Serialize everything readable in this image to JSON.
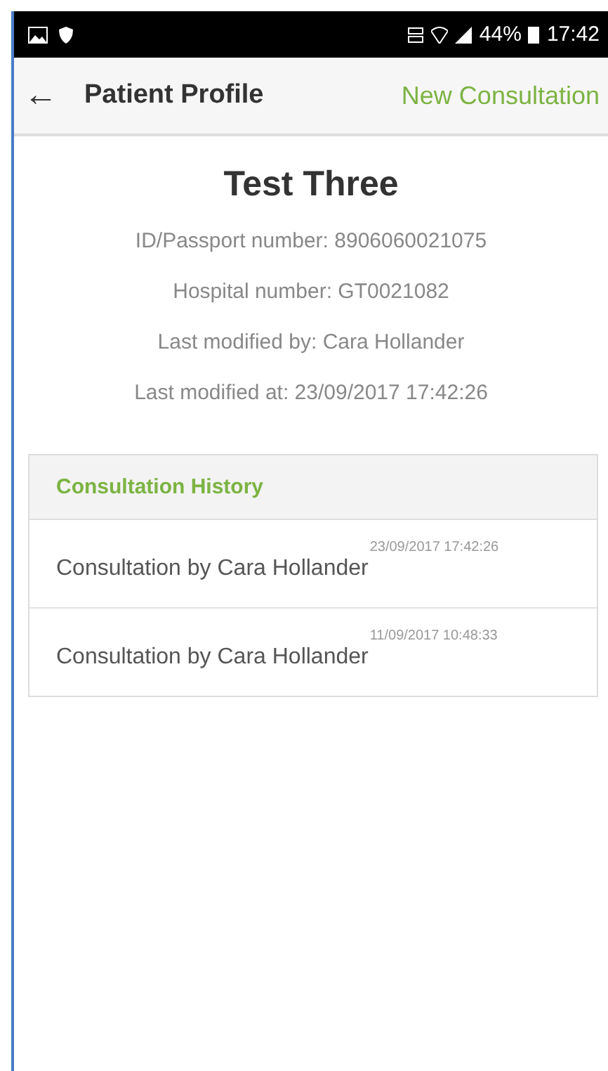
{
  "status_bar": {
    "battery": "44%",
    "time": "17:42"
  },
  "app_bar": {
    "back": "←",
    "title": "Patient Profile",
    "action": "New Consultation"
  },
  "patient": {
    "name": "Test Three",
    "details": [
      "ID/Passport number: 8906060021075",
      "Hospital number: GT0021082",
      "Last modified by: Cara Hollander",
      "Last modified at: 23/09/2017 17:42:26"
    ]
  },
  "consultation_history": {
    "title": "Consultation History",
    "items": [
      {
        "label": "Consultation by Cara Hollander",
        "timestamp": "23/09/2017 17:42:26"
      },
      {
        "label": "Consultation by Cara Hollander",
        "timestamp": "11/09/2017 10:48:33"
      }
    ]
  }
}
